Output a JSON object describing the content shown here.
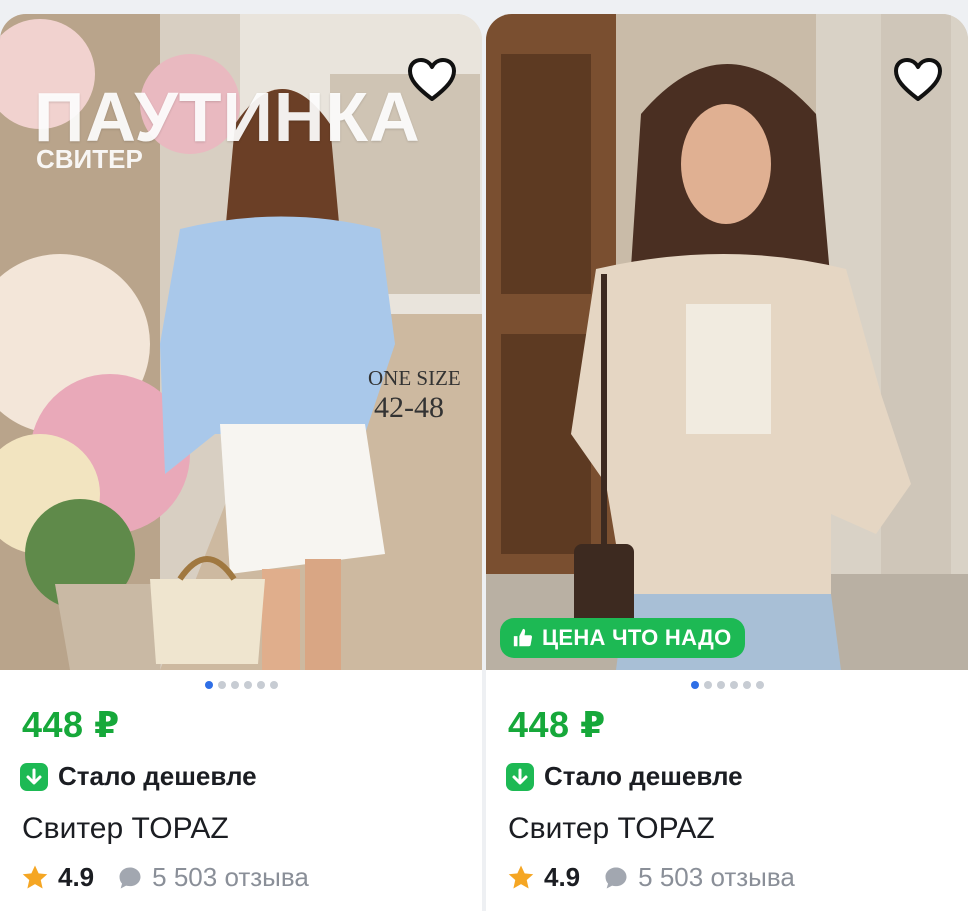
{
  "cards": [
    {
      "brand": "ПАУТИНКА",
      "brand_sub": "СВИТЕР",
      "size_line1": "ONE SIZE",
      "size_line2": "42-48",
      "price": "448 ₽",
      "discount_label": "Стало дешевле",
      "title": "Свитер TOPAZ",
      "rating": "4.9",
      "reviews": "5 503 отзыва",
      "carousel": {
        "count": 6,
        "active": 1
      },
      "icons": [
        "heart-icon",
        "arrow-down-icon",
        "star-icon",
        "chat-bubble-icon"
      ]
    },
    {
      "promo_label": "ЦЕНА ЧТО НАДО",
      "price": "448 ₽",
      "discount_label": "Стало дешевле",
      "title": "Свитер TOPAZ",
      "rating": "4.9",
      "reviews": "5 503 отзыва",
      "carousel": {
        "count": 6,
        "active": 1
      },
      "icons": [
        "heart-icon",
        "thumbs-up-icon",
        "arrow-down-icon",
        "star-icon",
        "chat-bubble-icon"
      ]
    }
  ],
  "colors": {
    "price": "#16a83a",
    "promo_badge": "#1db954",
    "dot_active": "#2f6fe6",
    "star": "#f5a623"
  }
}
